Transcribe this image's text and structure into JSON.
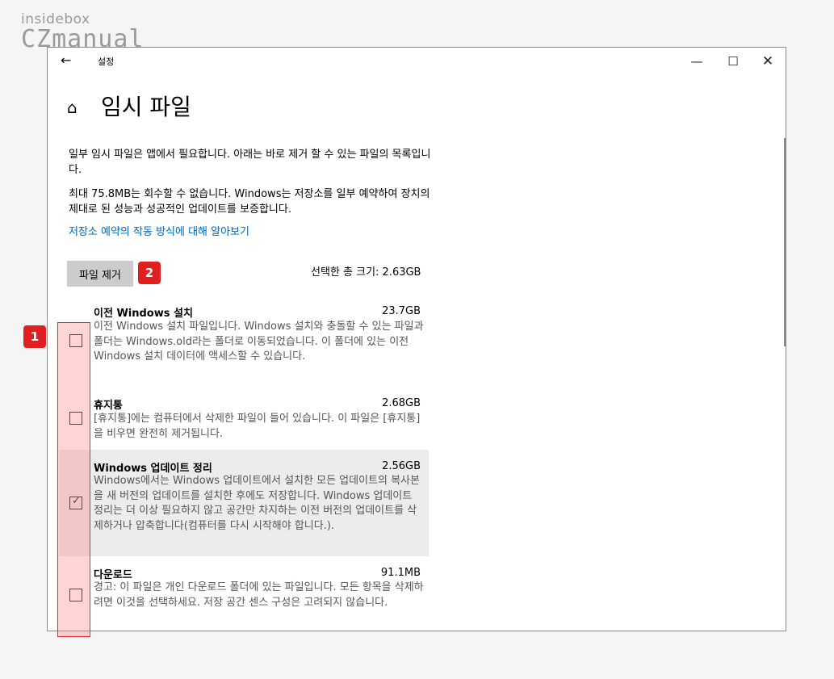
{
  "brand": {
    "line1": "insidebox",
    "line2": "CZmanual"
  },
  "window": {
    "title": "설정",
    "back_glyph": "←",
    "min_glyph": "—",
    "max_glyph": "☐",
    "close_glyph": "✕"
  },
  "page": {
    "home_glyph": "⌂",
    "title": "임시 파일",
    "para1": "일부 임시 파일은 앱에서 필요합니다. 아래는 바로 제거 할 수 있는 파일의 목록입니다.",
    "para2": "최대 75.8MB는 회수할 수 없습니다. Windows는 저장소를 일부 예약하여 장치의 제대로 된 성능과 성공적인 업데이트를 보증합니다.",
    "link": "저장소 예약의 작동 방식에 대해 알아보기",
    "remove_button": "파일 제거",
    "total_label": "선택한 총 크기: 2.63GB"
  },
  "badges": {
    "b1": "1",
    "b2": "2"
  },
  "items": [
    {
      "title": "이전 Windows 설치",
      "size": "23.7GB",
      "desc": "이전 Windows 설치 파일입니다. Windows 설치와 충돌할 수 있는 파일과 폴더는 Windows.old라는 폴더로 이동되었습니다. 이 폴더에 있는 이전 Windows 설치 데이터에 액세스할 수 있습니다.",
      "checked": false
    },
    {
      "title": "휴지통",
      "size": "2.68GB",
      "desc": "[휴지통]에는 컴퓨터에서 삭제한 파일이 들어 있습니다. 이 파일은 [휴지통]을 비우면 완전히 제거됩니다.",
      "checked": false
    },
    {
      "title": "Windows 업데이트 정리",
      "size": "2.56GB",
      "desc": "Windows에서는 Windows 업데이트에서 설치한 모든 업데이트의 복사본을 새 버전의 업데이트를 설치한 후에도 저장합니다. Windows 업데이트 정리는 더 이상 필요하지 않고 공간만 차지하는 이전 버전의 업데이트를 삭제하거나 압축합니다(컴퓨터를 다시 시작해야 합니다.).",
      "checked": true
    },
    {
      "title": "다운로드",
      "size": "91.1MB",
      "desc": "경고: 이 파일은 개인 다운로드 폴더에 있는 파일입니다. 모든 항목을 삭제하려면 이것을 선택하세요. 저장 공간 센스 구성은 고려되지 않습니다.",
      "checked": false
    }
  ],
  "check_glyph": "✓"
}
